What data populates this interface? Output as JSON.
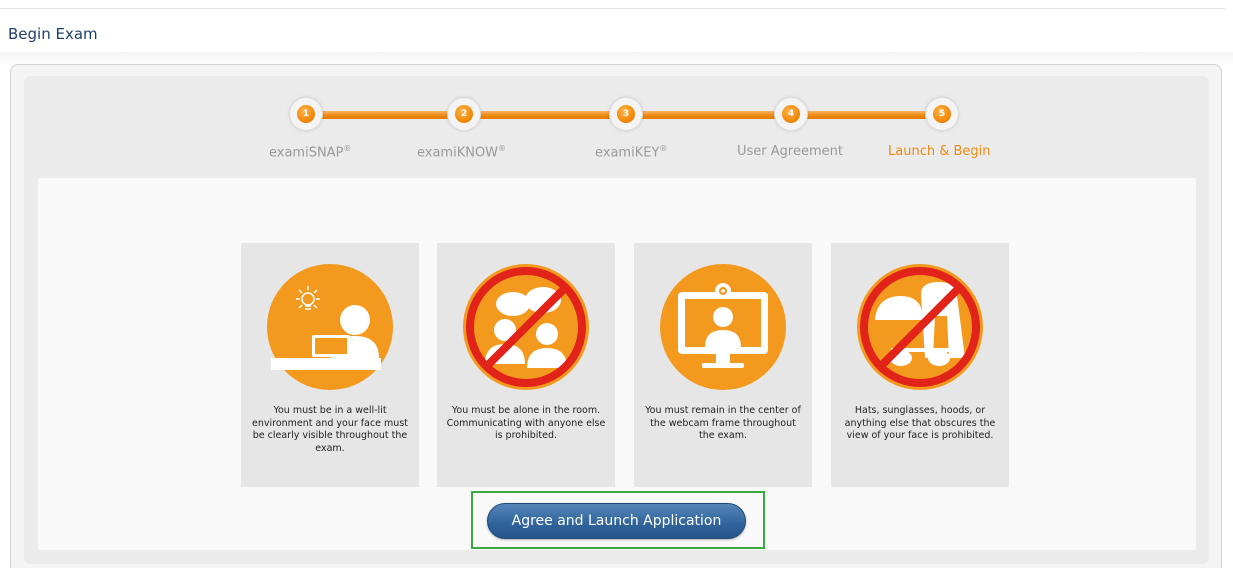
{
  "page": {
    "title": "Begin Exam"
  },
  "steps": [
    {
      "number": "1",
      "label": "examiSNAP",
      "mark": "®",
      "active": false
    },
    {
      "number": "2",
      "label": "examiKNOW",
      "mark": "®",
      "active": false
    },
    {
      "number": "3",
      "label": "examiKEY",
      "mark": "®",
      "active": false
    },
    {
      "number": "4",
      "label": "User Agreement",
      "mark": "",
      "active": false
    },
    {
      "number": "5",
      "label": "Launch & Begin",
      "mark": "",
      "active": true
    }
  ],
  "cards": [
    {
      "icon": "well-lit-desk-icon",
      "text": "You must be in a well-lit environment and your face must be clearly visible throughout the exam."
    },
    {
      "icon": "no-other-people-icon",
      "text": "You must be alone in the room. Communicating with anyone else is prohibited."
    },
    {
      "icon": "webcam-center-icon",
      "text": "You must remain in the center of the webcam frame throughout the exam."
    },
    {
      "icon": "no-hats-sunglasses-hoods-icon",
      "text": "Hats, sunglasses, hoods, or anything else that obscures the view of your face is prohibited."
    }
  ],
  "actions": {
    "agree_launch_label": "Agree and Launch Application"
  },
  "colors": {
    "accent": "#ef8a12",
    "prohibited": "#e2231a",
    "button": "#2f639a",
    "highlight_frame": "#3aa843",
    "title": "#1f3f66"
  }
}
